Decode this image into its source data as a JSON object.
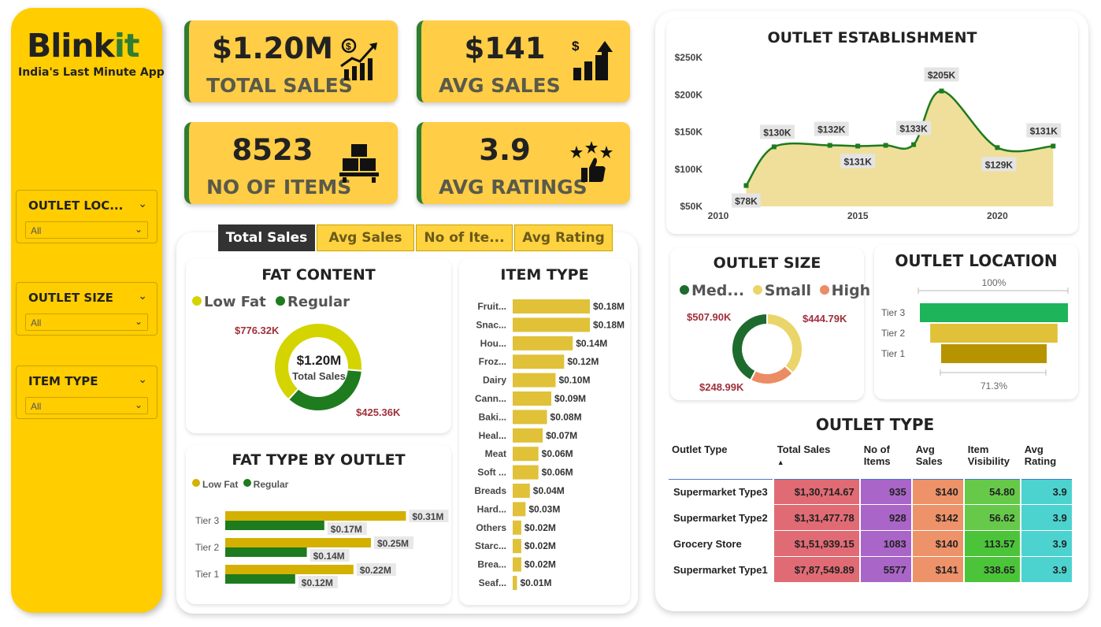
{
  "brand": {
    "name_main": "Blink",
    "name_accent": "it",
    "tagline": "India's Last Minute App"
  },
  "filters": [
    {
      "label": "OUTLET LOC...",
      "value": "All"
    },
    {
      "label": "OUTLET SIZE",
      "value": "All"
    },
    {
      "label": "ITEM TYPE",
      "value": "All"
    }
  ],
  "kpis": [
    {
      "value": "$1.20M",
      "label": "TOTAL SALES",
      "icon": "sales-growth-icon"
    },
    {
      "value": "$141",
      "label": "AVG SALES",
      "icon": "dollar-bar-up-icon"
    },
    {
      "value": "8523",
      "label": "NO OF ITEMS",
      "icon": "boxes-icon"
    },
    {
      "value": "3.9",
      "label": "AVG RATINGS",
      "icon": "stars-thumb-icon"
    }
  ],
  "tabs": [
    "Total Sales",
    "Avg Sales",
    "No of Ite...",
    "Avg Rating"
  ],
  "colors": {
    "accent": "#ffcd00",
    "green": "#1e7b1e",
    "lowfat": "#d4d400",
    "bar": "#e0c138",
    "lowfat_bar": "#d4b000",
    "label_red": "#a0303a"
  },
  "fat_content": {
    "title": "FAT CONTENT",
    "legend": [
      "Low Fat",
      "Regular"
    ],
    "center_value": "$1.20M",
    "center_label": "Total Sales",
    "chart_data": {
      "type": "pie",
      "labels": [
        "Low Fat",
        "Regular"
      ],
      "values": [
        776.32,
        425.36
      ],
      "unit": "$K",
      "data_labels": [
        "$776.32K",
        "$425.36K"
      ]
    }
  },
  "fat_by_outlet": {
    "title": "FAT TYPE BY OUTLET",
    "legend": [
      "Low Fat",
      "Regular"
    ],
    "chart_data": {
      "type": "bar",
      "orientation": "horizontal",
      "categories": [
        "Tier 3",
        "Tier 2",
        "Tier 1"
      ],
      "series": [
        {
          "name": "Low Fat",
          "values": [
            0.31,
            0.25,
            0.22
          ],
          "labels": [
            "$0.31M",
            "$0.25M",
            "$0.22M"
          ]
        },
        {
          "name": "Regular",
          "values": [
            0.17,
            0.14,
            0.12
          ],
          "labels": [
            "$0.17M",
            "$0.14M",
            "$0.12M"
          ]
        }
      ]
    }
  },
  "item_type": {
    "title": "ITEM TYPE",
    "chart_data": {
      "type": "bar",
      "orientation": "horizontal",
      "categories": [
        "Fruit...",
        "Snac...",
        "Hou...",
        "Froz...",
        "Dairy",
        "Cann...",
        "Baki...",
        "Heal...",
        "Meat",
        "Soft ...",
        "Breads",
        "Hard...",
        "Others",
        "Starc...",
        "Brea...",
        "Seaf..."
      ],
      "values": [
        0.18,
        0.18,
        0.14,
        0.12,
        0.1,
        0.09,
        0.08,
        0.07,
        0.06,
        0.06,
        0.04,
        0.03,
        0.02,
        0.02,
        0.02,
        0.01
      ],
      "labels": [
        "$0.18M",
        "$0.18M",
        "$0.14M",
        "$0.12M",
        "$0.10M",
        "$0.09M",
        "$0.08M",
        "$0.07M",
        "$0.06M",
        "$0.06M",
        "$0.04M",
        "$0.03M",
        "$0.02M",
        "$0.02M",
        "$0.02M",
        "$0.01M"
      ]
    }
  },
  "establishment": {
    "title": "OUTLET ESTABLISHMENT",
    "chart_data": {
      "type": "area",
      "x": [
        2011,
        2012,
        2014,
        2015,
        2016,
        2017,
        2018,
        2020,
        2022
      ],
      "y": [
        78,
        130,
        132,
        131,
        132,
        133,
        205,
        129,
        131
      ],
      "labels": [
        "$78K",
        "$130K",
        "$132K",
        "$131K",
        "",
        "$133K",
        "$205K",
        "$129K",
        "$131K"
      ],
      "yticks": [
        "$50K",
        "$100K",
        "$150K",
        "$200K",
        "$250K"
      ],
      "ytick_values": [
        50,
        100,
        150,
        200,
        250
      ],
      "xticks": [
        2010,
        2015,
        2020
      ],
      "ylim": [
        50,
        250
      ],
      "xlim": [
        2010,
        2022.5
      ]
    }
  },
  "outlet_size": {
    "title": "OUTLET SIZE",
    "legend": [
      "Med...",
      "Small",
      "High"
    ],
    "chart_data": {
      "type": "pie",
      "labels": [
        "Medium",
        "Small",
        "High"
      ],
      "values": [
        507.9,
        444.79,
        248.99
      ],
      "data_labels": [
        "$507.90K",
        "$444.79K",
        "$248.99K"
      ]
    }
  },
  "outlet_location": {
    "title": "OUTLET LOCATION",
    "top_label": "100%",
    "bottom_label": "71.3%",
    "chart_data": {
      "type": "funnel",
      "categories": [
        "Tier 3",
        "Tier 2",
        "Tier 1"
      ],
      "values": [
        100,
        86,
        71.3
      ]
    }
  },
  "outlet_type": {
    "title": "OUTLET TYPE",
    "headers": [
      "Outlet Type",
      "Total Sales",
      "No of Items",
      "Avg Sales",
      "Item Visibility",
      "Avg Rating"
    ],
    "rows": [
      [
        "Supermarket Type3",
        "$1,30,714.67",
        "935",
        "$140",
        "54.80",
        "3.9"
      ],
      [
        "Supermarket Type2",
        "$1,31,477.78",
        "928",
        "$142",
        "56.62",
        "3.9"
      ],
      [
        "Grocery Store",
        "$1,51,939.15",
        "1083",
        "$140",
        "113.57",
        "3.9"
      ],
      [
        "Supermarket Type1",
        "$7,87,549.89",
        "5577",
        "$141",
        "338.65",
        "3.9"
      ]
    ]
  }
}
